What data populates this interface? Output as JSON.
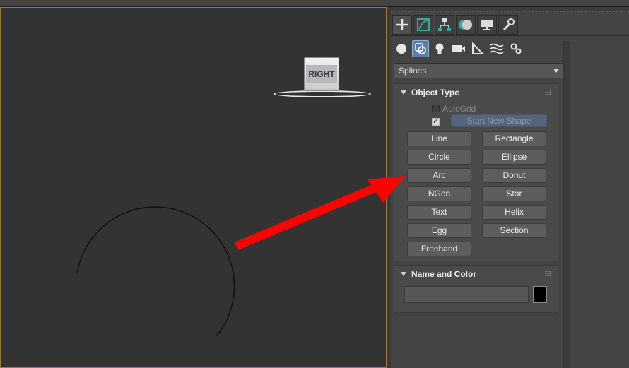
{
  "viewcube": {
    "label": "RIGHT"
  },
  "command_panel": {
    "tabs": [
      {
        "icon": "create-plus-icon",
        "active": true
      },
      {
        "icon": "modify-icon",
        "active": false
      },
      {
        "icon": "hierarchy-icon",
        "active": false
      },
      {
        "icon": "motion-icon",
        "active": false
      },
      {
        "icon": "display-icon",
        "active": false
      },
      {
        "icon": "utilities-wrench-icon",
        "active": false
      }
    ],
    "categories": [
      {
        "icon": "geometry-sphere-icon",
        "active": false
      },
      {
        "icon": "shapes-icon",
        "active": true
      },
      {
        "icon": "lights-bulb-icon",
        "active": false
      },
      {
        "icon": "cameras-icon",
        "active": false
      },
      {
        "icon": "helpers-ruler-icon",
        "active": false
      },
      {
        "icon": "space-warps-icon",
        "active": false
      },
      {
        "icon": "systems-gears-icon",
        "active": false
      }
    ],
    "dropdown_value": "Splines"
  },
  "object_type": {
    "title": "Object Type",
    "autogrid_label": "AutoGrid",
    "start_new_shape_label": "Start New Shape",
    "buttons": [
      "Line",
      "Rectangle",
      "Circle",
      "Ellipse",
      "Arc",
      "Donut",
      "NGon",
      "Star",
      "Text",
      "Helix",
      "Egg",
      "Section",
      "Freehand"
    ]
  },
  "name_and_color": {
    "title": "Name and Color",
    "name_value": "",
    "color": "#000000"
  },
  "colors": {
    "viewport_border": "#9a7a3a",
    "annotation_arrow": "#ff0000",
    "active_accent": "#5b7fa6"
  }
}
